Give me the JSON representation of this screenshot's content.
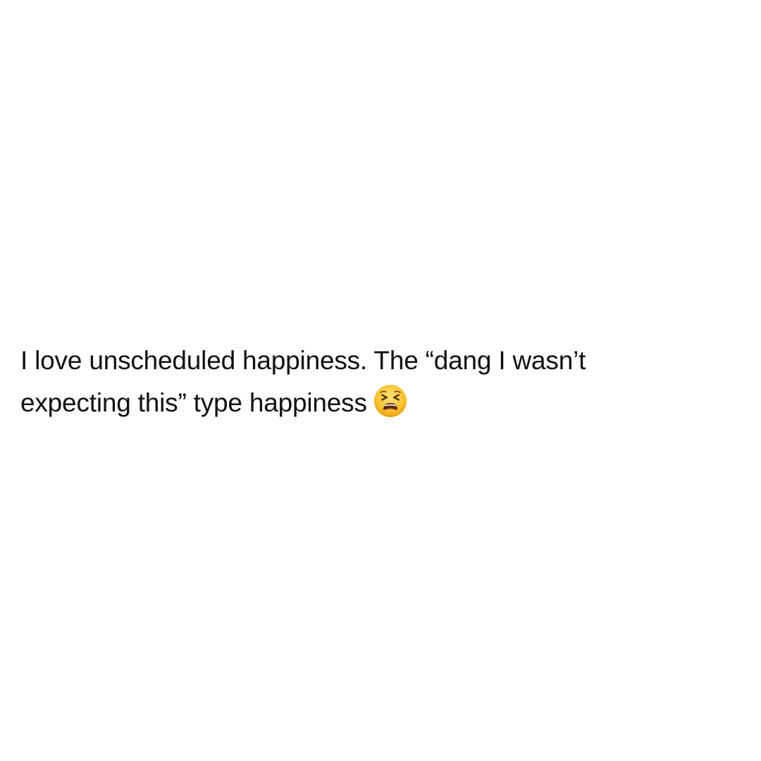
{
  "post": {
    "line1": "I love unscheduled happiness. The “dang I wasn’t",
    "line2": "expecting this” type happiness",
    "emoji": "tired-face-emoji",
    "text_color": "#111111",
    "background_color": "#ffffff"
  }
}
